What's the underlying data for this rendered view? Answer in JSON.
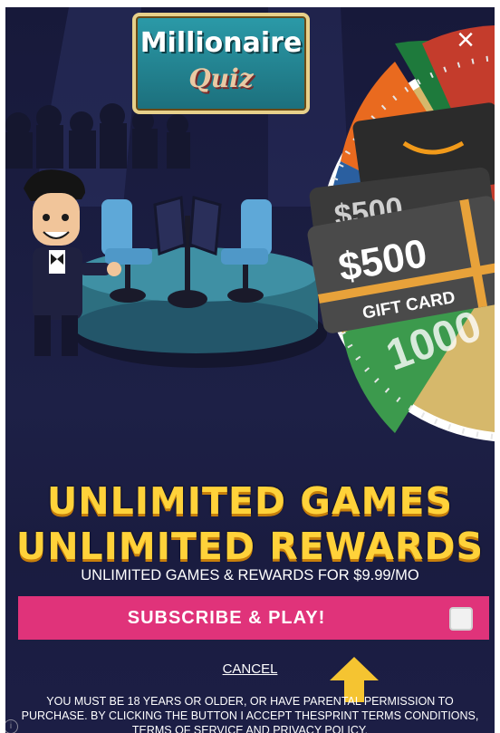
{
  "logo": {
    "line1": "Millionaire",
    "line2": "Quiz"
  },
  "close_icon": "×",
  "prize": {
    "amount_back": "$500",
    "amount": "$500",
    "label": "GIFT CARD",
    "wheel_value": "1000"
  },
  "headline": {
    "line1": "UNLIMITED GAMES",
    "line2": "UNLIMITED REWARDS"
  },
  "sub_text": "UNLIMITED GAMES & REWARDS FOR $9.99/MO",
  "subscribe": {
    "label": "SUBSCRIBE & PLAY!"
  },
  "cancel": "CANCEL",
  "legal": "YOU MUST BE 18 YEARS OR OLDER, OR HAVE PARENTAL PERMISSION TO PURCHASE. BY CLICKING THE BUTTON I ACCEPT THESPRINT TERMS CONDITIONS, TERMS OF SERVICE AND PRIVACY POLICY.",
  "colors": {
    "background": "#1b1d43",
    "headline": "#ffd23a",
    "subscribe_button": "#e0337a",
    "arrow": "#f5c431"
  }
}
